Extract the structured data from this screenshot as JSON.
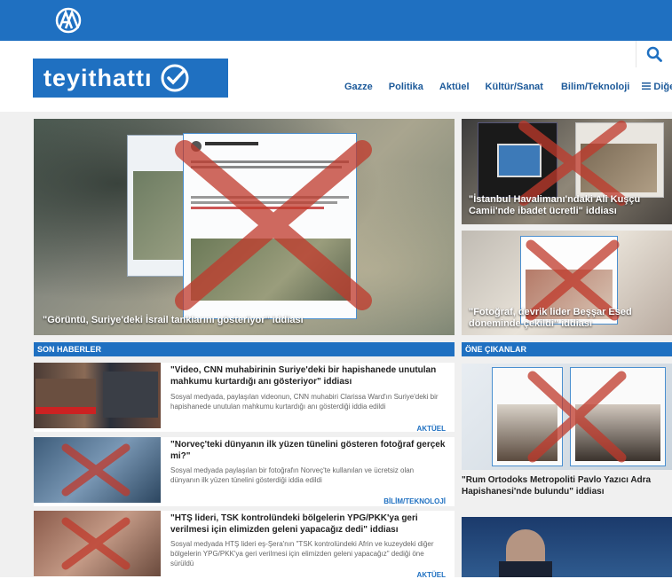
{
  "header": {
    "brand_name": "teyithattı",
    "logo_text": "AA",
    "search_icon": "search-icon"
  },
  "nav": {
    "items": [
      "Gazze",
      "Politika",
      "Aktüel",
      "Kültür/Sanat",
      "Bilim/Teknoloji",
      "Diğe"
    ],
    "menu_icon": "menu-icon"
  },
  "hero": {
    "caption": "\"Görüntü, Suriye'deki İsrail tanklarını gösteriyor\" iddiası"
  },
  "side": [
    {
      "caption": "\"İstanbul Havalimanı'ndaki Ali Kuşçu Camii'nde ibadet ücretli\" iddiası"
    },
    {
      "caption": "\"Fotoğraf, devrik lider Beşşar Esed döneminde çekildi\" iddiası"
    }
  ],
  "sections": {
    "son_haberler": "SON HABERLER",
    "one_cikanlar": "ÖNE ÇIKANLAR"
  },
  "news": [
    {
      "title": "\"Video, CNN muhabirinin Suriye'deki bir hapishanede unutulan mahkumu kurtardığı anı gösteriyor\" iddiası",
      "desc": "Sosyal medyada, paylaşılan videonun, CNN muhabiri Clarissa Ward'ın Suriye'deki bir hapishanede unutulan mahkumu kurtardığı anı gösterdiği iddia edildi",
      "category": "AKTÜEL"
    },
    {
      "title": "\"Norveç'teki dünyanın ilk yüzen tünelini gösteren fotoğraf gerçek mi?\"",
      "desc": "Sosyal medyada paylaşılan bir fotoğrafın Norveç'te kullanılan ve ücretsiz olan dünyanın ilk yüzen tünelini gösterdiği iddia edildi",
      "category": "BİLİM/TEKNOLOJİ"
    },
    {
      "title": "\"HTŞ lideri, TSK kontrolündeki bölgelerin YPG/PKK'ya geri verilmesi için elimizden geleni yapacağız dedi\" iddiası",
      "desc": "Sosyal medyada HTŞ lideri eş-Şera'nın \"TSK kontrolündeki Afrin ve kuzeydeki diğer bölgelerin YPG/PKK'ya geri verilmesi için elimizden geleni yapacağız\" dediği öne sürüldü",
      "category": "AKTÜEL"
    }
  ],
  "featured": {
    "title": "\"Rum Ortodoks Metropoliti Pavlo Yazıcı Adra Hapishanesi'nde bulundu\" iddiası"
  },
  "colors": {
    "brand_blue": "#1f70c1",
    "fake_red": "#c0392b"
  }
}
